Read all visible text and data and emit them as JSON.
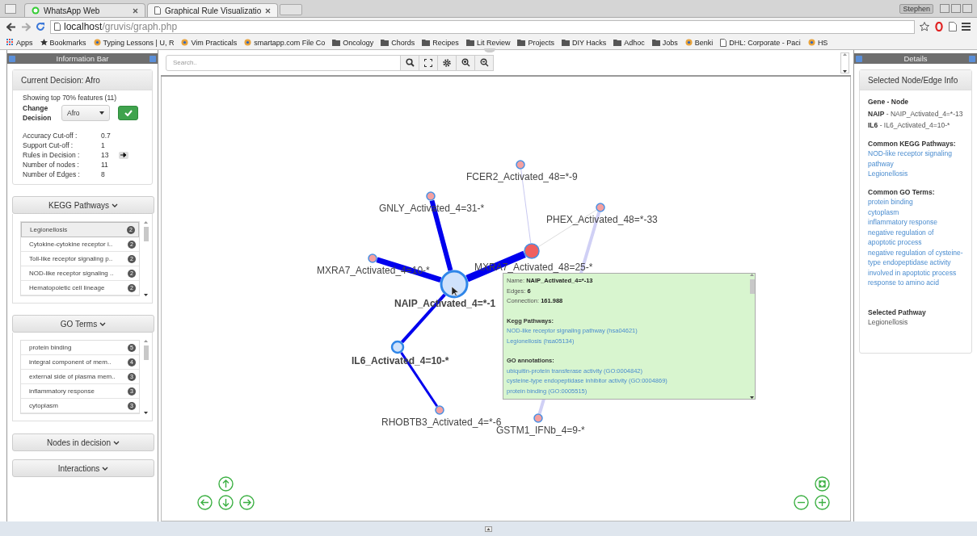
{
  "browser": {
    "tabs": [
      {
        "title": "WhatsApp Web",
        "kind": "chat",
        "selected": false
      },
      {
        "title": "Graphical Rule Visualizatio",
        "kind": "page",
        "selected": true
      }
    ],
    "user": "Stephen",
    "url_host": "localhost",
    "url_path": "/gruvis/graph.php",
    "bookmarks": [
      {
        "label": "Apps",
        "kind": "apps"
      },
      {
        "label": "Bookmarks",
        "kind": "star"
      },
      {
        "label": "Typing Lessons | U, R",
        "kind": "site"
      },
      {
        "label": "Vim Practicals",
        "kind": "site"
      },
      {
        "label": "smartapp.com File Co",
        "kind": "site"
      },
      {
        "label": "Oncology",
        "kind": "folder"
      },
      {
        "label": "Chords",
        "kind": "folder"
      },
      {
        "label": "Recipes",
        "kind": "folder"
      },
      {
        "label": "Lit Review",
        "kind": "folder"
      },
      {
        "label": "Projects",
        "kind": "folder"
      },
      {
        "label": "DIY Hacks",
        "kind": "folder"
      },
      {
        "label": "Adhoc",
        "kind": "folder"
      },
      {
        "label": "Jobs",
        "kind": "folder"
      },
      {
        "label": "Benki",
        "kind": "site"
      },
      {
        "label": "DHL: Corporate - Paci",
        "kind": "page"
      },
      {
        "label": "HS",
        "kind": "site"
      }
    ]
  },
  "info_bar": {
    "title": "Information Bar",
    "decision": {
      "title": "Current Decision: Afro",
      "showing": "Showing top 70% features (11)",
      "change_label": "Change Decision",
      "select_value": "Afro"
    },
    "stats": [
      {
        "label": "Accuracy Cut-off :",
        "value": "0.7",
        "kind": "plain"
      },
      {
        "label": "Support Cut-off :",
        "value": "1",
        "kind": "plain"
      },
      {
        "label": "Rules in Decision :",
        "value": "13",
        "kind": "link"
      },
      {
        "label": "Number of nodes :",
        "value": "11",
        "kind": "plain"
      },
      {
        "label": "Number of Edges :",
        "value": "8",
        "kind": "plain"
      }
    ],
    "kegg": {
      "title": "KEGG Pathways",
      "items": [
        {
          "label": "Legionellosis",
          "count": "2",
          "selected": true
        },
        {
          "label": "Cytokine-cytokine receptor i..",
          "count": "2",
          "selected": false
        },
        {
          "label": "Toll-like receptor signaling p..",
          "count": "2",
          "selected": false
        },
        {
          "label": "NOD-like receptor signaling ..",
          "count": "2",
          "selected": false
        },
        {
          "label": "Hematopoietic cell lineage",
          "count": "2",
          "selected": false
        }
      ]
    },
    "go": {
      "title": "GO Terms",
      "items": [
        {
          "label": "protein binding",
          "count": "5",
          "selected": false
        },
        {
          "label": "integral component of mem..",
          "count": "4",
          "selected": false
        },
        {
          "label": "external side of plasma mem..",
          "count": "3",
          "selected": false
        },
        {
          "label": "inflammatory response",
          "count": "3",
          "selected": false
        },
        {
          "label": "cytoplasm",
          "count": "3",
          "selected": false
        }
      ]
    },
    "sections": [
      "Nodes in decision",
      "Interactions"
    ]
  },
  "graph": {
    "search": {
      "placeholder": "Search.."
    },
    "nodes": [
      {
        "label": "FCER2_Activated_48=*-9",
        "kind": "gene"
      },
      {
        "label": "PHEX_Activated_48=*-33",
        "kind": "gene"
      },
      {
        "label": "GNLY_Activated_4=31-*",
        "kind": "gene"
      },
      {
        "label": "MXRA7_Activated_4=10-*",
        "kind": "gene"
      },
      {
        "label": "MXRA7_Activated_48=25-*",
        "kind": "hub"
      },
      {
        "label": "NAIP_Activated_4=*-1",
        "kind": "selected"
      },
      {
        "label": "IL6_Activated_4=10-*",
        "kind": "linked"
      },
      {
        "label": "RHOBTB3_Activated_4=*-6",
        "kind": "gene"
      },
      {
        "label": "GSTM1_IFNb_4=9-*",
        "kind": "gene"
      }
    ],
    "tooltip": {
      "rows": [
        {
          "label": "Name:",
          "value": "NAIP_Activated_4=*-13"
        },
        {
          "label": "Edges:",
          "value": "6"
        },
        {
          "label": "Connection:",
          "value": "161.988"
        }
      ],
      "kegg_title": "Kegg Pathways:",
      "kegg": [
        "NOD-like receptor signaling pathway (hsa04621)",
        "Legionellosis (hsa05134)"
      ],
      "go_title": "GO annotations:",
      "go": [
        "ubiquitin-protein transferase activity (GO:0004842)",
        "cysteine-type endopeptidase inhibitor activity (GO:0004869)",
        "protein binding (GO:0005515)"
      ]
    }
  },
  "details": {
    "title": "Details",
    "card_title": "Selected Node/Edge Info",
    "gene_title": "Gene - Node",
    "genes": [
      {
        "gene": "NAIP",
        "node": "- NAIP_Activated_4=*-13"
      },
      {
        "gene": "IL6",
        "node": "- IL6_Activated_4=10-*"
      }
    ],
    "kegg_title": "Common KEGG Pathways:",
    "kegg": [
      "NOD-like receptor signaling pathway",
      "Legionellosis"
    ],
    "go_title": "Common GO Terms:",
    "go": [
      "protein binding",
      "cytoplasm",
      "inflammatory response",
      "negative regulation of apoptotic process",
      "negative regulation of cysteine-type endopeptidase activity involved in apoptotic process",
      "response to amino acid"
    ],
    "pathway_title": "Selected Pathway",
    "pathway": "Legionellosis"
  }
}
